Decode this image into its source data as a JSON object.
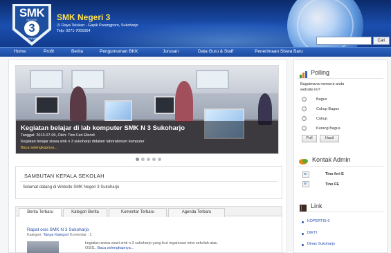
{
  "header": {
    "logo_text": "SMK",
    "logo_sub": "NEGERI",
    "logo_number": "3",
    "logo_city": "SUKOHARJO",
    "title": "SMK Negeri 3",
    "address": "Jl. Raya Telukan - Gapik Parangporo, Sukoharjo",
    "phone": "Telp: 0271-7001654",
    "search_placeholder": "",
    "search_button": "Cari"
  },
  "nav": {
    "items": [
      "Home",
      "Profil",
      "Berita",
      "Pengumuman BKK",
      "Jurusan",
      "Data Guru & Staff",
      "Penerimaan Siswa Baru"
    ]
  },
  "slider": {
    "title": "Kegiatan belajar di lab komputer SMK N 3 Sukoharjo",
    "meta": "Tanggal: 2013-07-09, Oleh: Tino Feri Efendi",
    "desc": "Kegiatan belajar siswa smk n 3 sukoharjo didalam laboratorium komputer",
    "more": "Baca selengkapnya..."
  },
  "welcome": {
    "title": "SAMBUTAN KEPALA SEKOLAH",
    "text": "Selamat datang di Website SMK Negeri 3 Sukoharjo"
  },
  "tabs": {
    "items": [
      "Berita Terbaru",
      "Kategori Berita",
      "Komentar Terbaru",
      "Agenda Terbaru"
    ],
    "post": {
      "title": "Rapat osis SMK N 3 Sukoharjo",
      "meta_prefix": "Kategori:",
      "category": "Tanpa Kategori",
      "comments": "Komentar : 1",
      "text1": "kegiatan siswa-siswi smk n 3 sukoharjo yang ikut organisasi intra sekolah atau",
      "text2": "OSIS..",
      "more": "Baca selengkapnya..."
    }
  },
  "polling": {
    "title": "Polling",
    "question1": "Bagaimana menurut anda",
    "question2": "website ini?",
    "options": [
      "Bagus",
      "Cukup Bagus",
      "Cukup",
      "Kurang Bagus"
    ],
    "poll_button": "Poll",
    "result_button": "Hasil"
  },
  "admin": {
    "title": "Kontak Admin",
    "names": [
      "Tino feri E",
      "Tino FE"
    ]
  },
  "links": {
    "title": "Link",
    "items": [
      "KOPERTIS 6",
      "DIKTI",
      "Dinas Sukoharjo"
    ]
  },
  "colors": {
    "header": "#1b4fb0",
    "nav": "#1c4aa0",
    "title_yellow": "#ffe14a",
    "link_blue": "#2b4fa8"
  }
}
